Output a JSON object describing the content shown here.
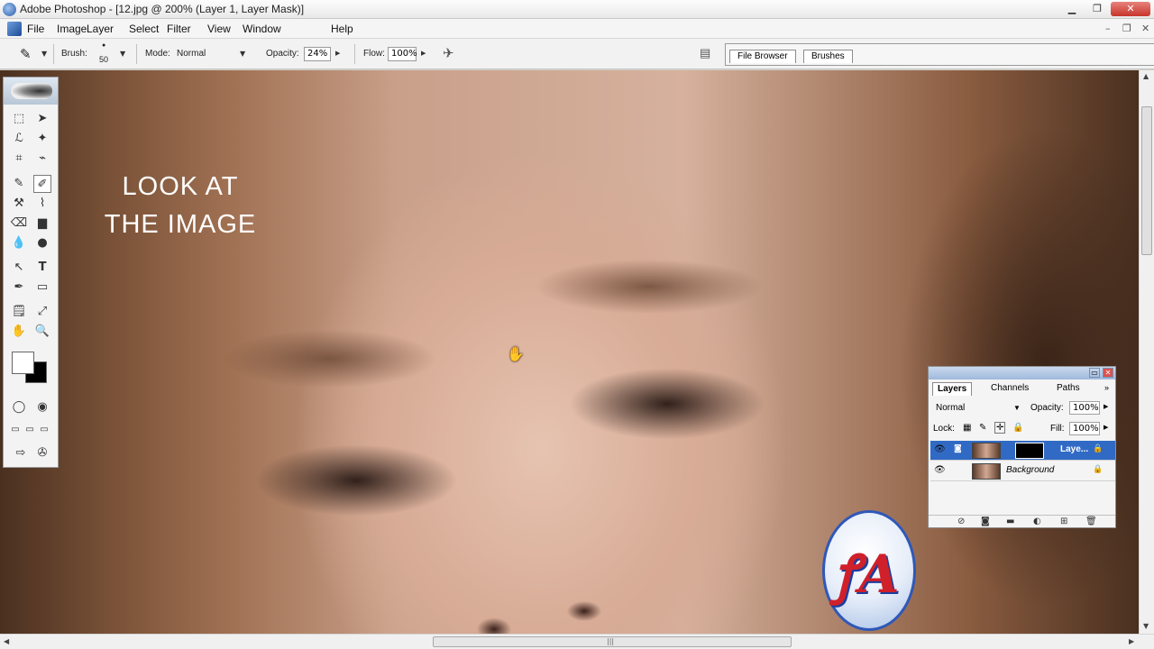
{
  "window": {
    "title": "Adobe Photoshop - [12.jpg @ 200% (Layer 1, Layer Mask)]",
    "minimize": "▁",
    "maximize": "❐",
    "close": "✕"
  },
  "menu": {
    "items": [
      "File",
      "Image",
      "Layer",
      "Select",
      "Filter",
      "View",
      "Window",
      "Help"
    ],
    "doc_controls": [
      "–",
      "❐",
      "✕"
    ]
  },
  "options": {
    "brush_label": "Brush:",
    "brush_size": "50",
    "mode_label": "Mode:",
    "mode_value": "Normal",
    "opacity_label": "Opacity:",
    "opacity_value": "24%",
    "flow_label": "Flow:",
    "flow_value": "100%",
    "well_tabs": [
      "File Browser",
      "Brushes"
    ]
  },
  "canvas": {
    "caption_line1": "LOOK AT",
    "caption_line2": "THE IMAGE",
    "cursor": "✋",
    "logo_glyph": "ꝭA"
  },
  "toolbox": {
    "tools": [
      "⬚",
      "➤",
      "ℒ",
      "✦",
      "⌗",
      "⌁",
      "✎",
      "✐",
      "⚒",
      "⌇",
      "⌫",
      "▆",
      "💧",
      "●",
      "↖",
      "T",
      "✒",
      "▭",
      "🗒",
      "⤢",
      "✋",
      "🔍",
      "◯",
      "◉",
      "▭",
      "▭",
      "▭",
      "⇨",
      "✇"
    ]
  },
  "layers": {
    "tabs": [
      "Layers",
      "Channels",
      "Paths"
    ],
    "blend_mode": "Normal",
    "opacity_label": "Opacity:",
    "opacity_value": "100%",
    "lock_label": "Lock:",
    "fill_label": "Fill:",
    "fill_value": "100%",
    "rows": [
      {
        "name": "Laye...",
        "selected": true
      },
      {
        "name": "Background",
        "selected": false
      }
    ],
    "footer_icons": [
      "⊘",
      "◙",
      "▬",
      "◐",
      "⊞",
      "🗑"
    ]
  }
}
